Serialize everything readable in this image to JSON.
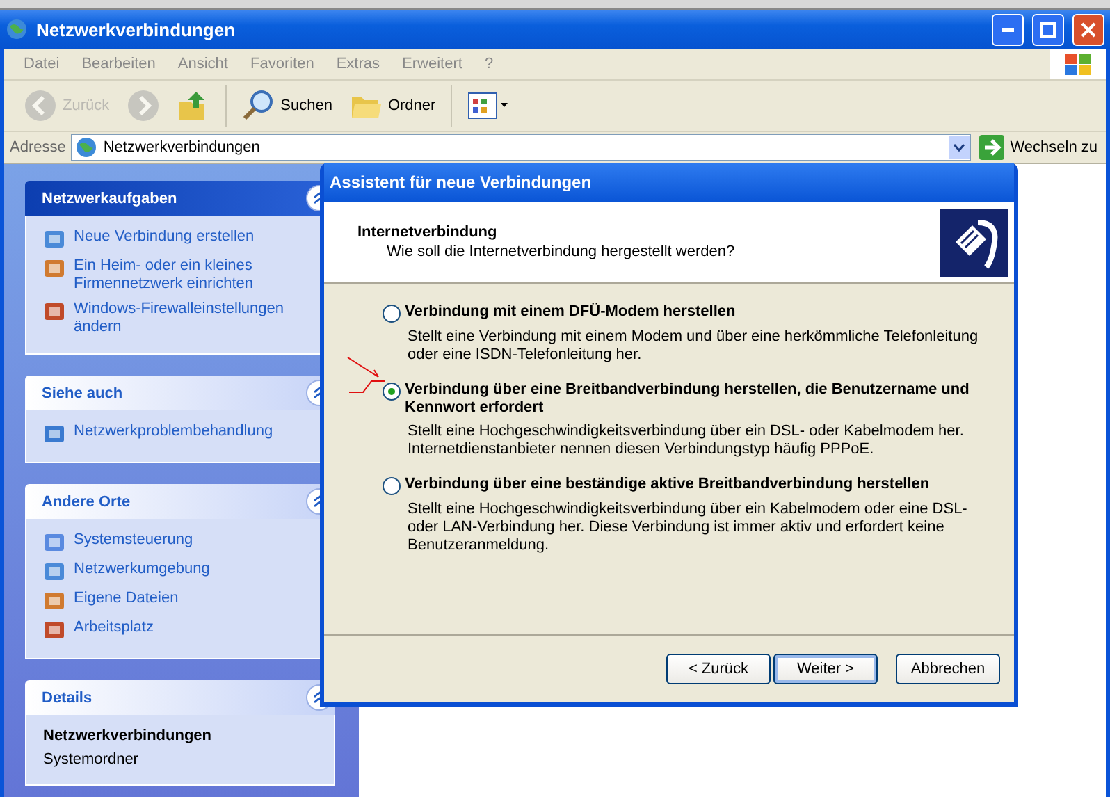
{
  "window": {
    "title": "Netzwerkverbindungen"
  },
  "menu": [
    "Datei",
    "Bearbeiten",
    "Ansicht",
    "Favoriten",
    "Extras",
    "Erweitert",
    "?"
  ],
  "toolbar": [
    {
      "kind": "back",
      "label": "Zurück",
      "disabled": true
    },
    {
      "kind": "forward",
      "disabled": true
    },
    {
      "kind": "up",
      "disabled": false
    },
    {
      "kind": "search",
      "label": "Suchen",
      "disabled": false
    },
    {
      "kind": "folders",
      "label": "Ordner",
      "disabled": false
    },
    {
      "kind": "views",
      "disabled": false
    }
  ],
  "address": {
    "label": "Adresse",
    "value": "Netzwerkverbindungen",
    "go": "Wechseln zu"
  },
  "sidebar": [
    {
      "title": "Netzwerkaufgaben",
      "kind": "links",
      "emphasized": true,
      "items": [
        "Neue Verbindung erstellen",
        "Ein Heim- oder ein kleines Firmennetzwerk einrichten",
        "Windows-Firewalleinstellungen ändern"
      ]
    },
    {
      "title": "Siehe auch",
      "kind": "links",
      "emphasized": false,
      "items": [
        "Netzwerkproblembehandlung"
      ]
    },
    {
      "title": "Andere Orte",
      "kind": "links",
      "emphasized": false,
      "items": [
        "Systemsteuerung",
        "Netzwerkumgebung",
        "Eigene Dateien",
        "Arbeitsplatz"
      ]
    },
    {
      "title": "Details",
      "kind": "details",
      "emphasized": false,
      "name": "Netzwerkverbindungen",
      "type": "Systemordner"
    }
  ],
  "dialog": {
    "title": "Assistent für neue Verbindungen",
    "heading": "Internetverbindung",
    "subheading": "Wie soll die Internetverbindung hergestellt werden?",
    "options": [
      {
        "label": "Verbindung mit einem DFÜ-Modem herstellen",
        "description": "Stellt eine Verbindung mit einem Modem und über eine herkömmliche Telefonleitung oder eine ISDN-Telefonleitung her.",
        "selected": false
      },
      {
        "label": "Verbindung über eine Breitbandverbindung herstellen, die Benutzername und Kennwort erfordert",
        "description": "Stellt eine Hochgeschwindigkeitsverbindung über ein DSL- oder Kabelmodem her. Internetdienstanbieter nennen diesen Verbindungstyp häufig PPPoE.",
        "selected": true
      },
      {
        "label": "Verbindung über eine beständige aktive Breitbandverbindung herstellen",
        "description": "Stellt eine Hochgeschwindigkeitsverbindung über ein Kabelmodem oder eine DSL- oder LAN-Verbindung her. Diese Verbindung ist immer aktiv und erfordert keine Benutzeranmeldung.",
        "selected": false
      }
    ],
    "buttons": [
      {
        "label": "< Zurück",
        "default": false
      },
      {
        "label": "Weiter >",
        "default": true
      },
      {
        "label": "Abbrechen",
        "default": false
      }
    ]
  }
}
